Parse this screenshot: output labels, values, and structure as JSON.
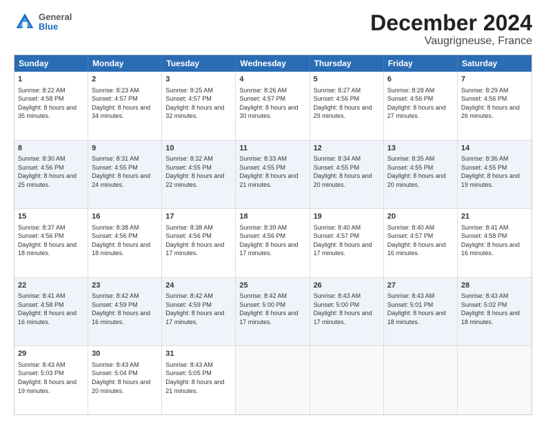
{
  "header": {
    "logo": {
      "general": "General",
      "blue": "Blue"
    },
    "title": "December 2024",
    "subtitle": "Vaugrigneuse, France"
  },
  "days": [
    "Sunday",
    "Monday",
    "Tuesday",
    "Wednesday",
    "Thursday",
    "Friday",
    "Saturday"
  ],
  "weeks": [
    [
      {
        "day": "1",
        "sunrise": "8:22 AM",
        "sunset": "4:58 PM",
        "daylight": "8 hours and 35 minutes."
      },
      {
        "day": "2",
        "sunrise": "8:23 AM",
        "sunset": "4:57 PM",
        "daylight": "8 hours and 34 minutes."
      },
      {
        "day": "3",
        "sunrise": "8:25 AM",
        "sunset": "4:57 PM",
        "daylight": "8 hours and 32 minutes."
      },
      {
        "day": "4",
        "sunrise": "8:26 AM",
        "sunset": "4:57 PM",
        "daylight": "8 hours and 30 minutes."
      },
      {
        "day": "5",
        "sunrise": "8:27 AM",
        "sunset": "4:56 PM",
        "daylight": "8 hours and 29 minutes."
      },
      {
        "day": "6",
        "sunrise": "8:28 AM",
        "sunset": "4:56 PM",
        "daylight": "8 hours and 27 minutes."
      },
      {
        "day": "7",
        "sunrise": "8:29 AM",
        "sunset": "4:56 PM",
        "daylight": "8 hours and 26 minutes."
      }
    ],
    [
      {
        "day": "8",
        "sunrise": "8:30 AM",
        "sunset": "4:56 PM",
        "daylight": "8 hours and 25 minutes."
      },
      {
        "day": "9",
        "sunrise": "8:31 AM",
        "sunset": "4:55 PM",
        "daylight": "8 hours and 24 minutes."
      },
      {
        "day": "10",
        "sunrise": "8:32 AM",
        "sunset": "4:55 PM",
        "daylight": "8 hours and 22 minutes."
      },
      {
        "day": "11",
        "sunrise": "8:33 AM",
        "sunset": "4:55 PM",
        "daylight": "8 hours and 21 minutes."
      },
      {
        "day": "12",
        "sunrise": "8:34 AM",
        "sunset": "4:55 PM",
        "daylight": "8 hours and 20 minutes."
      },
      {
        "day": "13",
        "sunrise": "8:35 AM",
        "sunset": "4:55 PM",
        "daylight": "8 hours and 20 minutes."
      },
      {
        "day": "14",
        "sunrise": "8:36 AM",
        "sunset": "4:55 PM",
        "daylight": "8 hours and 19 minutes."
      }
    ],
    [
      {
        "day": "15",
        "sunrise": "8:37 AM",
        "sunset": "4:56 PM",
        "daylight": "8 hours and 18 minutes."
      },
      {
        "day": "16",
        "sunrise": "8:38 AM",
        "sunset": "4:56 PM",
        "daylight": "8 hours and 18 minutes."
      },
      {
        "day": "17",
        "sunrise": "8:38 AM",
        "sunset": "4:56 PM",
        "daylight": "8 hours and 17 minutes."
      },
      {
        "day": "18",
        "sunrise": "8:39 AM",
        "sunset": "4:56 PM",
        "daylight": "8 hours and 17 minutes."
      },
      {
        "day": "19",
        "sunrise": "8:40 AM",
        "sunset": "4:57 PM",
        "daylight": "8 hours and 17 minutes."
      },
      {
        "day": "20",
        "sunrise": "8:40 AM",
        "sunset": "4:57 PM",
        "daylight": "8 hours and 16 minutes."
      },
      {
        "day": "21",
        "sunrise": "8:41 AM",
        "sunset": "4:58 PM",
        "daylight": "8 hours and 16 minutes."
      }
    ],
    [
      {
        "day": "22",
        "sunrise": "8:41 AM",
        "sunset": "4:58 PM",
        "daylight": "8 hours and 16 minutes."
      },
      {
        "day": "23",
        "sunrise": "8:42 AM",
        "sunset": "4:59 PM",
        "daylight": "8 hours and 16 minutes."
      },
      {
        "day": "24",
        "sunrise": "8:42 AM",
        "sunset": "4:59 PM",
        "daylight": "8 hours and 17 minutes."
      },
      {
        "day": "25",
        "sunrise": "8:42 AM",
        "sunset": "5:00 PM",
        "daylight": "8 hours and 17 minutes."
      },
      {
        "day": "26",
        "sunrise": "8:43 AM",
        "sunset": "5:00 PM",
        "daylight": "8 hours and 17 minutes."
      },
      {
        "day": "27",
        "sunrise": "8:43 AM",
        "sunset": "5:01 PM",
        "daylight": "8 hours and 18 minutes."
      },
      {
        "day": "28",
        "sunrise": "8:43 AM",
        "sunset": "5:02 PM",
        "daylight": "8 hours and 18 minutes."
      }
    ],
    [
      {
        "day": "29",
        "sunrise": "8:43 AM",
        "sunset": "5:03 PM",
        "daylight": "8 hours and 19 minutes."
      },
      {
        "day": "30",
        "sunrise": "8:43 AM",
        "sunset": "5:04 PM",
        "daylight": "8 hours and 20 minutes."
      },
      {
        "day": "31",
        "sunrise": "8:43 AM",
        "sunset": "5:05 PM",
        "daylight": "8 hours and 21 minutes."
      },
      null,
      null,
      null,
      null
    ]
  ],
  "labels": {
    "sunrise": "Sunrise:",
    "sunset": "Sunset:",
    "daylight": "Daylight:"
  }
}
